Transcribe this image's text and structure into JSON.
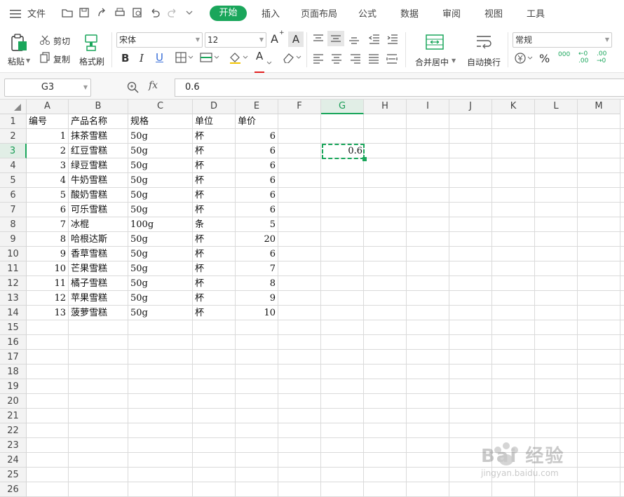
{
  "menubar": {
    "file_label": "文件",
    "tabs": [
      "开始",
      "插入",
      "页面布局",
      "公式",
      "数据",
      "审阅",
      "视图",
      "工具"
    ],
    "active_tab": "开始"
  },
  "ribbon": {
    "paste": "粘贴",
    "cut": "剪切",
    "copy": "复制",
    "format_painter": "格式刷",
    "font_name": "宋体",
    "font_size": "12",
    "merge_center": "合并居中",
    "wrap_text": "自动换行",
    "number_format": "常规",
    "font_increase": "A",
    "font_decrease": "A",
    "bold": "B",
    "italic": "I",
    "underline": "U",
    "font_color": "A",
    "percent": "%",
    "thousands": "000",
    "dec_inc": "←0 .00",
    "dec_dec": ".00 →0"
  },
  "formula_bar": {
    "name_box": "G3",
    "fx": "fx",
    "value": "0.6"
  },
  "sheet": {
    "columns": [
      "A",
      "B",
      "C",
      "D",
      "E",
      "F",
      "G",
      "H",
      "I",
      "J",
      "K",
      "L",
      "M"
    ],
    "rows": [
      "1",
      "2",
      "3",
      "4",
      "5",
      "6",
      "7",
      "8",
      "9",
      "10",
      "11",
      "12",
      "13",
      "14",
      "15",
      "16",
      "17",
      "18",
      "19",
      "20",
      "21",
      "22",
      "23",
      "24",
      "25",
      "26"
    ],
    "selected_cell": "G3",
    "headers": [
      "编号",
      "产品名称",
      "规格",
      "单位",
      "单价"
    ],
    "data": [
      [
        "1",
        "抹茶雪糕",
        "50g",
        "杯",
        "6"
      ],
      [
        "2",
        "红豆雪糕",
        "50g",
        "杯",
        "6"
      ],
      [
        "3",
        "绿豆雪糕",
        "50g",
        "杯",
        "6"
      ],
      [
        "4",
        "牛奶雪糕",
        "50g",
        "杯",
        "6"
      ],
      [
        "5",
        "酸奶雪糕",
        "50g",
        "杯",
        "6"
      ],
      [
        "6",
        "可乐雪糕",
        "50g",
        "杯",
        "6"
      ],
      [
        "7",
        "冰棍",
        "100g",
        "条",
        "5"
      ],
      [
        "8",
        "哈根达斯",
        "50g",
        "杯",
        "20"
      ],
      [
        "9",
        "香草雪糕",
        "50g",
        "杯",
        "6"
      ],
      [
        "10",
        "芒果雪糕",
        "50g",
        "杯",
        "7"
      ],
      [
        "11",
        "橘子雪糕",
        "50g",
        "杯",
        "8"
      ],
      [
        "12",
        "苹果雪糕",
        "50g",
        "杯",
        "9"
      ],
      [
        "13",
        "菠萝雪糕",
        "50g",
        "杯",
        "10"
      ]
    ],
    "g3_value": "0.6"
  },
  "watermark": {
    "brand": "Bai 经验",
    "url": "jingyan.baidu.com"
  },
  "colors": {
    "accent": "#1aa65b",
    "grid": "#dadada"
  }
}
